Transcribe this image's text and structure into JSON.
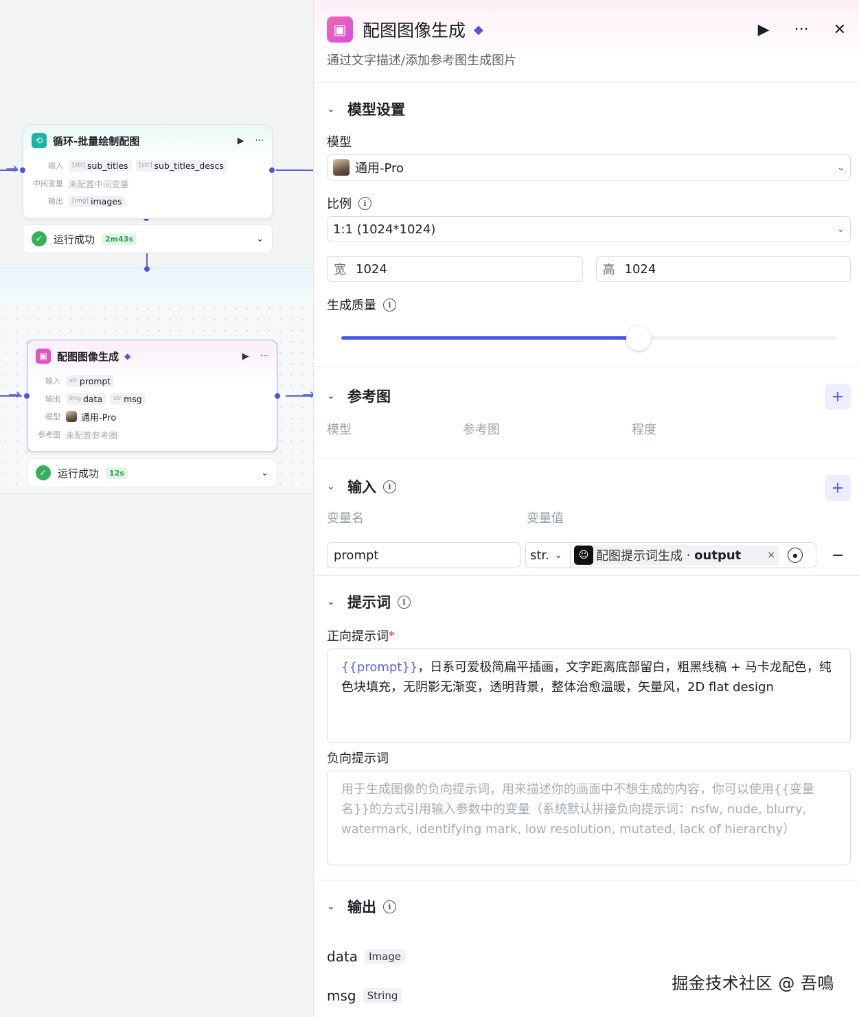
{
  "canvas": {
    "loop_node": {
      "title": "循环-批量绘制配图",
      "input_label": "输入",
      "inputs": [
        {
          "type": "[str]",
          "name": "sub_titles"
        },
        {
          "type": "[str]",
          "name": "sub_titles_descs"
        }
      ],
      "intermediate_label": "中间变量",
      "intermediate_value": "未配置中间变量",
      "output_label": "输出",
      "output": {
        "type": "[img]",
        "name": "images"
      },
      "status": {
        "text": "运行成功",
        "duration": "2m43s"
      }
    },
    "image_node": {
      "title": "配图图像生成",
      "input_label": "输入",
      "input": {
        "type": "str",
        "name": "prompt"
      },
      "output_label": "输出",
      "outputs": [
        {
          "type": "img",
          "name": "data"
        },
        {
          "type": "str",
          "name": "msg"
        }
      ],
      "model_label": "模型",
      "model_value": "通用-Pro",
      "ref_label": "参考图",
      "ref_value": "未配置参考图",
      "status": {
        "text": "运行成功",
        "duration": "12s"
      }
    }
  },
  "panel": {
    "title": "配图图像生成",
    "description": "通过文字描述/添加参考图生成图片",
    "model_settings": {
      "section_title": "模型设置",
      "model_label": "模型",
      "model_value": "通用-Pro",
      "ratio_label": "比例",
      "ratio_value": "1:1 (1024*1024)",
      "width_label": "宽",
      "width_value": "1024",
      "height_label": "高",
      "height_value": "1024",
      "quality_label": "生成质量",
      "quality_level": 0.6
    },
    "reference": {
      "section_title": "参考图",
      "columns": [
        "模型",
        "参考图",
        "程度"
      ]
    },
    "inputs": {
      "section_title": "输入",
      "columns": [
        "变量名",
        "变量值"
      ],
      "row": {
        "name": "prompt",
        "type": "str.",
        "ref_source": "配图提示词生成",
        "ref_separator": " · ",
        "ref_field": "output"
      }
    },
    "prompts": {
      "section_title": "提示词",
      "positive_label": "正向提示词",
      "positive_required_mark": "*",
      "positive_var": "{{prompt}}",
      "positive_text": "，日系可爱极简扁平插画，文字距离底部留白，粗黑线稿 + 马卡龙配色，纯色块填充，无阴影无渐变，透明背景，整体治愈温暖，矢量风，2D flat design",
      "negative_label": "负向提示词",
      "negative_placeholder": "用于生成图像的负向提示词，用来描述你的画面中不想生成的内容，你可以使用{{变量名}}的方式引用输入参数中的变量（系统默认拼接负向提示词：nsfw, nude, blurry, watermark, identifying mark, low resolution, mutated, lack of hierarchy）"
    },
    "outputs": {
      "section_title": "输出",
      "items": [
        {
          "name": "data",
          "type": "Image"
        },
        {
          "name": "msg",
          "type": "String"
        }
      ]
    }
  },
  "watermark": "掘金技术社区 @ 吾鳴",
  "colors": {
    "accent": "#4f55e8",
    "success": "#33b15a",
    "edge": "#5b63d8",
    "loop_icon": "#19b4a6",
    "image_icon": "#e055c2"
  },
  "icons": {
    "loop": "loop-icon",
    "image": "image-gen-icon",
    "play": "play-icon",
    "more": "more-icon",
    "close": "close-icon",
    "gem": "gem-icon",
    "info": "info-icon",
    "plus": "plus-icon",
    "minus": "minus-icon",
    "chevron": "chevron-down-icon",
    "check": "check-icon"
  }
}
